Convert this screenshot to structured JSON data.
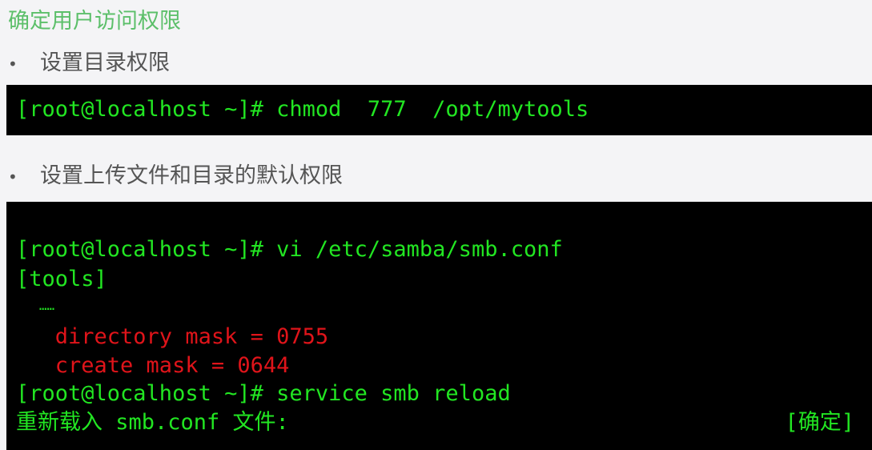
{
  "title": "确定用户访问权限",
  "bullets": [
    "设置目录权限",
    "设置上传文件和目录的默认权限"
  ],
  "terminal1": {
    "lines": [
      "[root@localhost ~]# chmod  777  /opt/mytools"
    ]
  },
  "terminal2": {
    "lines": [
      "[root@localhost ~]# vi /etc/samba/smb.conf",
      "[tools]",
      "   ……",
      "   directory mask = 0755",
      "   create mask = 0644",
      "[root@localhost ~]# service smb reload",
      "重新载入 smb.conf 文件:"
    ],
    "status": "[确定]"
  },
  "colors": {
    "prompt": "#22e622",
    "highlight": "#e0141a",
    "title": "#5cbf6a",
    "terminal_bg": "#000000"
  }
}
